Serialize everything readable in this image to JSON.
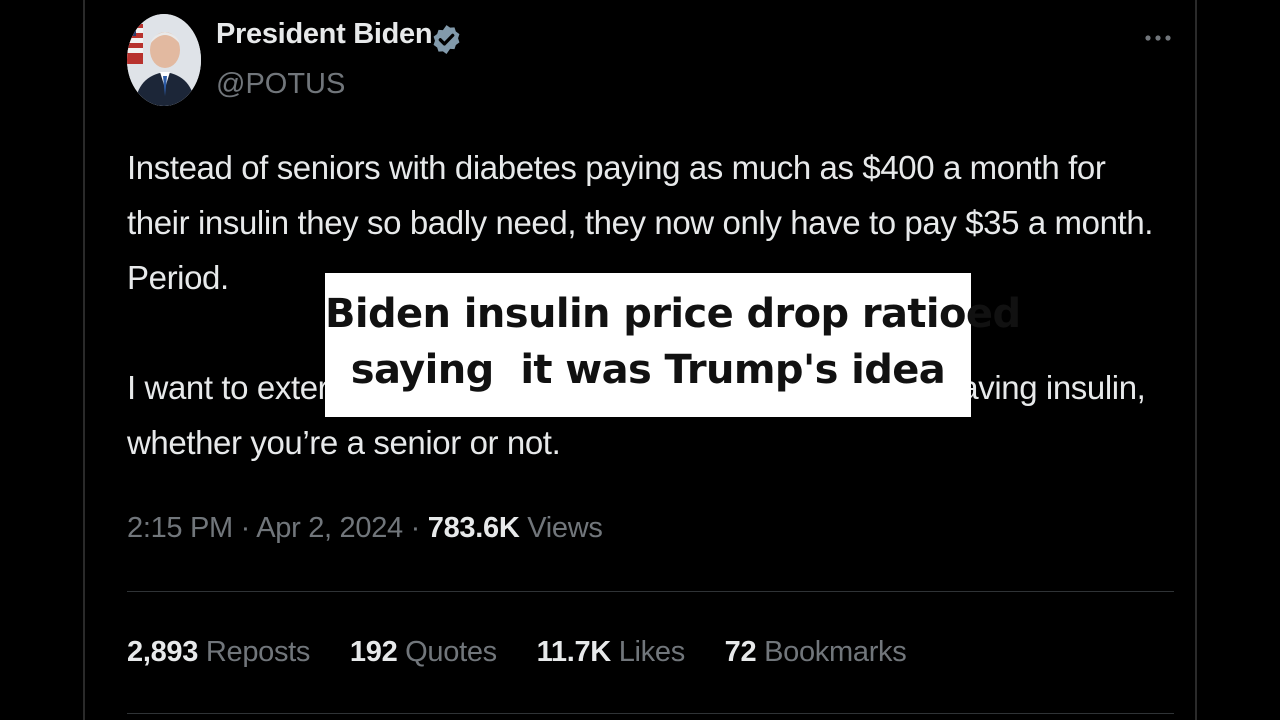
{
  "tweet": {
    "author_name": "President Biden",
    "handle": "@POTUS",
    "verified_icon": "verified-badge-icon",
    "more_icon": "more-options-icon",
    "body": {
      "paragraph1": [
        "Instead of seniors with diabetes paying as much as $400 a month for",
        "their insulin they so badly need, they now only have to pay $35 a month.",
        "Period."
      ],
      "paragraph2": [
        "I want to exter",
        "aving insulin,",
        "whether you’re a senior or not."
      ]
    },
    "meta": {
      "time": "2:15 PM",
      "separator": "·",
      "date": "Apr 2, 2024",
      "views_count": "783.6K",
      "views_label": "Views"
    },
    "stats": [
      {
        "count": "2,893",
        "label": "Reposts"
      },
      {
        "count": "192",
        "label": "Quotes"
      },
      {
        "count": "11.7K",
        "label": "Likes"
      },
      {
        "count": "72",
        "label": "Bookmarks"
      }
    ]
  },
  "overlay": {
    "line1": "Biden insulin price drop ratioed",
    "line2": "saying  it was Trump's idea"
  },
  "colors": {
    "background": "#000000",
    "primary_text": "#e7e9ea",
    "secondary_text": "#71767b",
    "verified": "#829aab",
    "overlay_bg": "#ffffff"
  }
}
